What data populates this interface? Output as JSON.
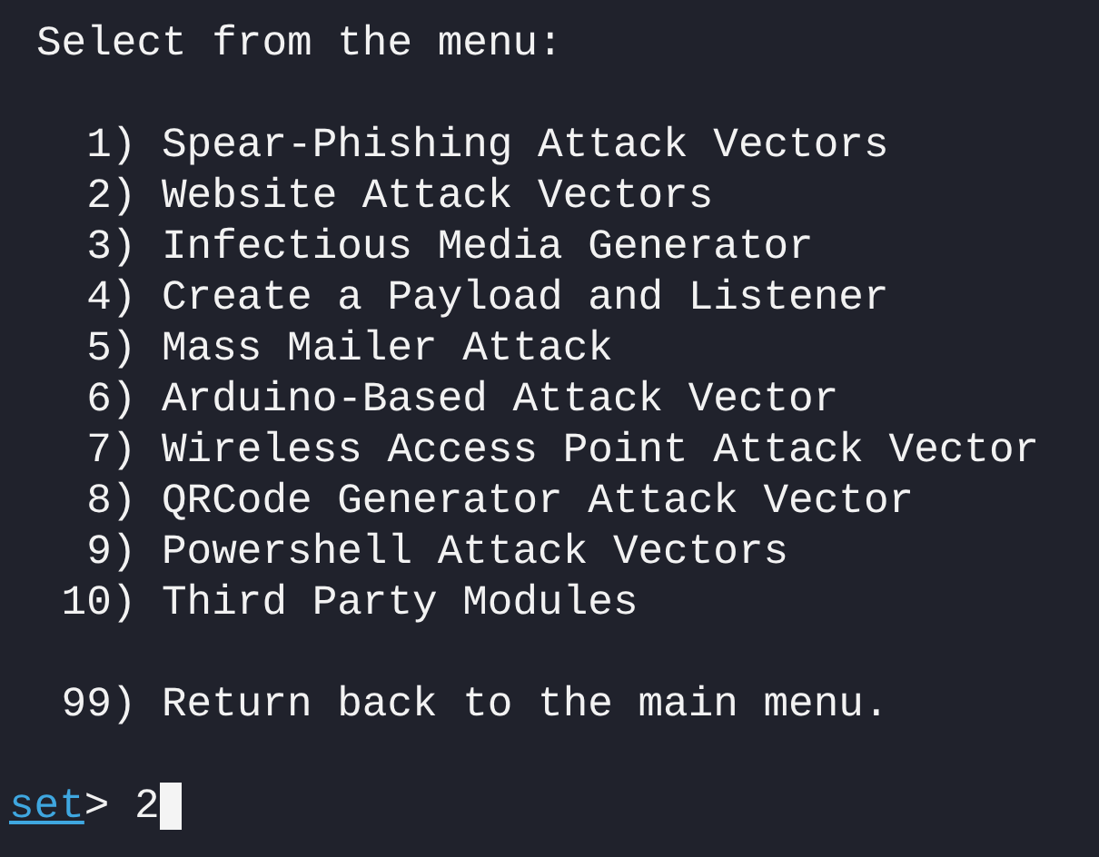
{
  "header": "Select from the menu:",
  "menu": [
    {
      "number": "1)",
      "label": "Spear-Phishing Attack Vectors"
    },
    {
      "number": "2)",
      "label": "Website Attack Vectors"
    },
    {
      "number": "3)",
      "label": "Infectious Media Generator"
    },
    {
      "number": "4)",
      "label": "Create a Payload and Listener"
    },
    {
      "number": "5)",
      "label": "Mass Mailer Attack"
    },
    {
      "number": "6)",
      "label": "Arduino-Based Attack Vector"
    },
    {
      "number": "7)",
      "label": "Wireless Access Point Attack Vector"
    },
    {
      "number": "8)",
      "label": "QRCode Generator Attack Vector"
    },
    {
      "number": "9)",
      "label": "Powershell Attack Vectors"
    },
    {
      "number": "10)",
      "label": "Third Party Modules"
    }
  ],
  "exit_option": {
    "number": "99)",
    "label": "Return back to the main menu."
  },
  "prompt": {
    "name": "set",
    "symbol": ">",
    "input": "2"
  }
}
